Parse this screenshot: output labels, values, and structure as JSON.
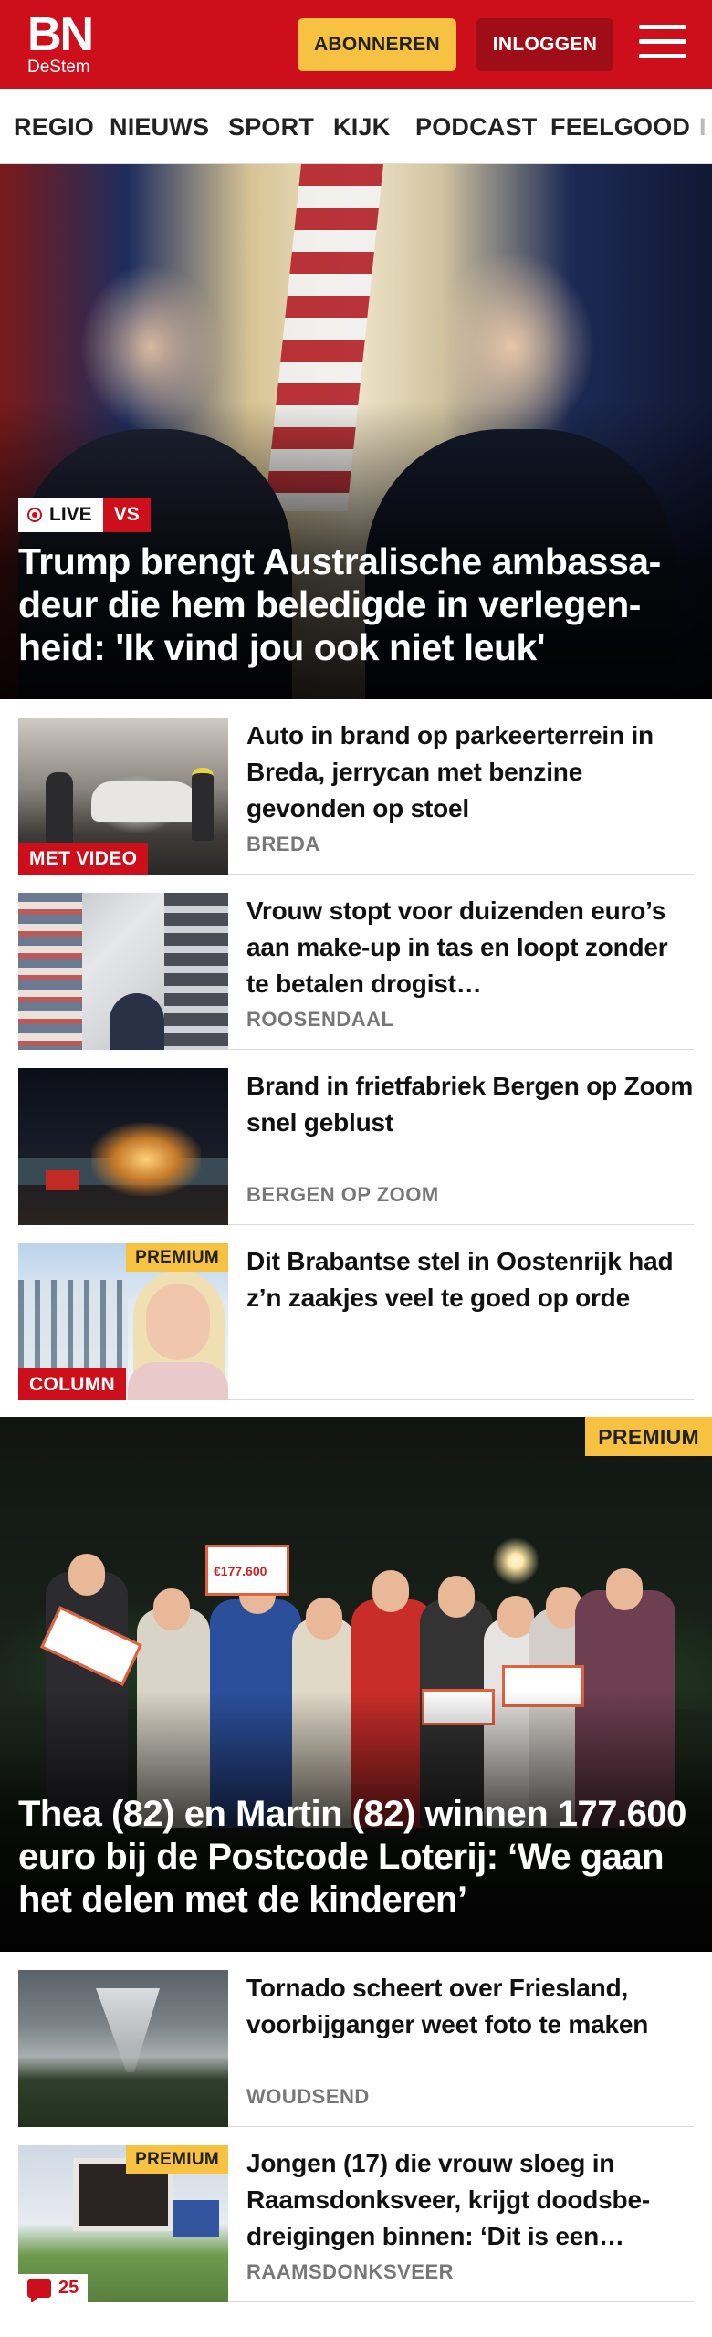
{
  "header": {
    "logo_main": "BN",
    "logo_sub": "DeStem",
    "subscribe_label": "ABONNEREN",
    "login_label": "INLOGGEN"
  },
  "nav": {
    "items": [
      "REGIO",
      "NIEUWS",
      "SPORT",
      "KIJK",
      "PODCAST",
      "FEELGOOD",
      "I"
    ]
  },
  "hero": {
    "live_label": "LIVE",
    "tag_label": "VS",
    "title": "Trump brengt Australische ambassa-deur die hem beledigde in verlegen-heid: 'Ik vind jou ook niet leuk'"
  },
  "articles": [
    {
      "title": "Auto in brand op parkeerterrein in Breda, jerrycan met benzine gevonden op stoel",
      "location": "BREDA",
      "badge": "MET VIDEO"
    },
    {
      "title": "Vrouw stopt voor duizenden euro’s aan make-up in tas en loopt zonder te betalen drogist…",
      "location": "ROOSENDAAL"
    },
    {
      "title": "Brand in frietfabriek Bergen op Zoom snel geblust",
      "location": "BERGEN OP ZOOM"
    },
    {
      "title": "Dit Brabantse stel in Oostenrijk had z’n zaakjes veel te goed op orde",
      "premium": "PREMIUM",
      "badge": "COLUMN"
    }
  ],
  "feature": {
    "premium": "PREMIUM",
    "card_amount": "€177.600",
    "title": "Thea (82) en Martin (82) winnen 177.600 euro bij de Postcode Loterij: ‘We gaan het delen met de kinderen’"
  },
  "articles2": [
    {
      "title": "Tornado scheert over Friesland, voorbijganger weet foto te maken",
      "location": "WOUDSEND"
    },
    {
      "title": "Jongen (17) die vrouw sloeg in Raamsdonksveer, krijgt doodsbe-dreigingen binnen: ‘Dit is een…",
      "location": "RAAMSDONKSVEER",
      "premium": "PREMIUM",
      "comments": "25"
    }
  ],
  "colors": {
    "brand_red": "#cc0f1b",
    "premium_yellow": "#f7c142",
    "login_dark_red": "#9f0d17"
  }
}
